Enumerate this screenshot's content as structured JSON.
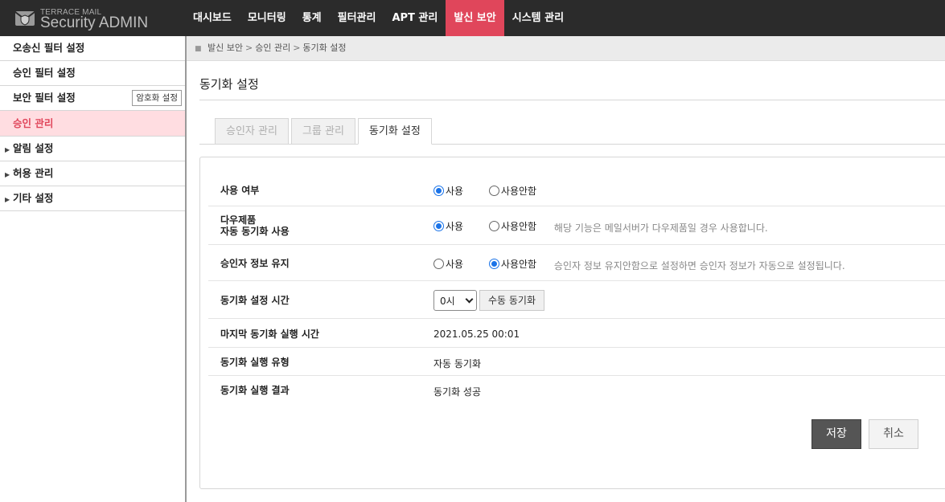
{
  "header": {
    "logo_small": "TERRACE MAIL",
    "logo_big": "Security ADMIN",
    "nav": [
      {
        "label": "대시보드",
        "active": false
      },
      {
        "label": "모니터링",
        "active": false
      },
      {
        "label": "통계",
        "active": false
      },
      {
        "label": "필터관리",
        "active": false
      },
      {
        "label": "APT 관리",
        "active": false
      },
      {
        "label": "발신 보안",
        "active": true
      },
      {
        "label": "시스템 관리",
        "active": false
      }
    ]
  },
  "sidebar": {
    "items": [
      {
        "label": "오송신 필터 설정"
      },
      {
        "label": "승인 필터 설정"
      },
      {
        "label": "보안 필터 설정",
        "badge": "암호화 설정"
      },
      {
        "label": "승인 관리",
        "active": true
      },
      {
        "label": "알림 설정",
        "collapsible": true
      },
      {
        "label": "허용 관리",
        "collapsible": true
      },
      {
        "label": "기타 설정",
        "collapsible": true
      }
    ]
  },
  "breadcrumb": [
    "발신 보안",
    "승인 관리",
    "동기화 설정"
  ],
  "page_title": "동기화 설정",
  "tabs": [
    {
      "label": "승인자 관리",
      "active": false
    },
    {
      "label": "그룹 관리",
      "active": false
    },
    {
      "label": "동기화 설정",
      "active": true
    }
  ],
  "form": {
    "use": {
      "label": "사용 여부",
      "options": [
        "사용",
        "사용안함"
      ],
      "selected": "사용"
    },
    "multi": {
      "label_line1": "다우제품",
      "label_line2": "자동 동기화 사용",
      "options": [
        "사용",
        "사용안함"
      ],
      "selected": "사용",
      "hint": "해당 기능은 메일서버가 다우제품일 경우 사용합니다."
    },
    "keep": {
      "label": "승인자 정보 유지",
      "options": [
        "사용",
        "사용안함"
      ],
      "selected": "사용안함",
      "hint": "승인자 정보 유지안함으로 설정하면 승인자 정보가 자동으로 설정됩니다."
    },
    "sync_time": {
      "label": "동기화 설정 시간",
      "select_value": "0시",
      "manual_button": "수동 동기화"
    },
    "last_run": {
      "label": "마지막 동기화 실행 시간",
      "value": "2021.05.25 00:01"
    },
    "run_type": {
      "label": "동기화 실행 유형",
      "value": "자동 동기화"
    },
    "run_result": {
      "label": "동기화 실행 결과",
      "value": "동기화 성공"
    }
  },
  "buttons": {
    "save": "저장",
    "cancel": "취소"
  },
  "colors": {
    "accent": "#e0465b",
    "topbar": "#2b2b2b",
    "sidebar_active_bg": "#ffdde1",
    "radio": "#1a73e8"
  },
  "icons": {
    "logo": "envelope-shield-icon",
    "collapse": "triangle-right-icon",
    "select": "chevron-down-icon"
  }
}
